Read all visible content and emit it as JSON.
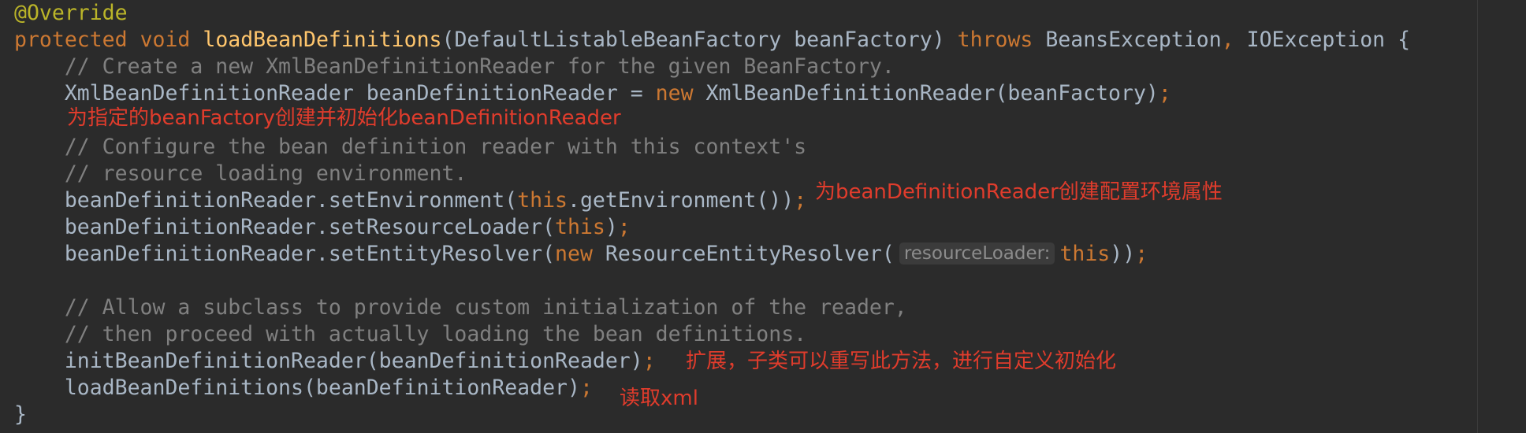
{
  "editor": {
    "colors": {
      "background": "#2b2b2b",
      "keyword": "#cc7832",
      "annotation": "#bbb529",
      "method_declaration": "#ffc66d",
      "comment": "#808080",
      "plain": "#a9b7c6",
      "inlay_hint": "#8c8c8c",
      "note": "#e03c2c"
    },
    "lines": [
      [
        {
          "t": "@Override",
          "c": "ann"
        }
      ],
      [
        {
          "t": "protected",
          "c": "kw"
        },
        {
          "t": " ",
          "c": "plain"
        },
        {
          "t": "void",
          "c": "kw"
        },
        {
          "t": " ",
          "c": "plain"
        },
        {
          "t": "loadBeanDefinitions",
          "c": "fn"
        },
        {
          "t": "(DefaultListableBeanFactory beanFactory) ",
          "c": "plain"
        },
        {
          "t": "throws",
          "c": "kw"
        },
        {
          "t": " BeansException",
          "c": "plain"
        },
        {
          "t": ",",
          "c": "kw"
        },
        {
          "t": " IOException {",
          "c": "plain"
        }
      ],
      [
        {
          "t": "    // Create a new XmlBeanDefinitionReader for the given BeanFactory.",
          "c": "cm"
        }
      ],
      [
        {
          "t": "    XmlBeanDefinitionReader beanDefinitionReader = ",
          "c": "plain"
        },
        {
          "t": "new",
          "c": "kw"
        },
        {
          "t": " XmlBeanDefinitionReader(beanFactory)",
          "c": "plain"
        },
        {
          "t": ";",
          "c": "kw"
        }
      ],
      [],
      [
        {
          "t": "    // Configure the bean definition reader with this context's",
          "c": "cm"
        }
      ],
      [
        {
          "t": "    // resource loading environment.",
          "c": "cm"
        }
      ],
      [
        {
          "t": "    beanDefinitionReader.setEnvironment(",
          "c": "plain"
        },
        {
          "t": "this",
          "c": "kw"
        },
        {
          "t": ".getEnvironment())",
          "c": "plain"
        },
        {
          "t": ";",
          "c": "kw"
        }
      ],
      [
        {
          "t": "    beanDefinitionReader.setResourceLoader(",
          "c": "plain"
        },
        {
          "t": "this",
          "c": "kw"
        },
        {
          "t": ")",
          "c": "plain"
        },
        {
          "t": ";",
          "c": "kw"
        }
      ],
      [
        {
          "t": "    beanDefinitionReader.setEntityResolver(",
          "c": "plain"
        },
        {
          "t": "new",
          "c": "kw"
        },
        {
          "t": " ResourceEntityResolver(",
          "c": "plain"
        },
        {
          "hint": "resourceLoader:"
        },
        {
          "t": "this",
          "c": "kw"
        },
        {
          "t": "))",
          "c": "plain"
        },
        {
          "t": ";",
          "c": "kw"
        }
      ],
      [],
      [
        {
          "t": "    // Allow a subclass to provide custom initialization of the reader,",
          "c": "cm"
        }
      ],
      [
        {
          "t": "    // then proceed with actually loading the bean definitions.",
          "c": "cm"
        }
      ],
      [
        {
          "t": "    initBeanDefinitionReader(beanDefinitionReader)",
          "c": "plain"
        },
        {
          "t": ";",
          "c": "kw"
        }
      ],
      [
        {
          "t": "    loadBeanDefinitions(beanDefinitionReader)",
          "c": "plain"
        },
        {
          "t": ";",
          "c": "kw"
        }
      ],
      [
        {
          "t": "}",
          "c": "plain"
        }
      ]
    ]
  },
  "notes": {
    "create_reader": "为指定的beanFactory创建并初始化beanDefinitionReader",
    "environment": "为beanDefinitionReader创建配置环境属性",
    "extend": "扩展，子类可以重写此方法，进行自定义初始化",
    "read_xml": "读取xml"
  }
}
